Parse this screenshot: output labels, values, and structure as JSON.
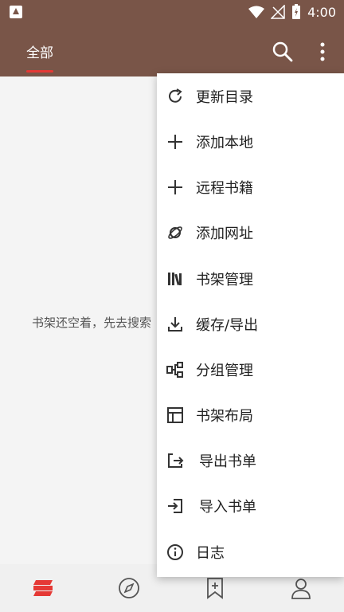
{
  "status_bar": {
    "time": "4:00"
  },
  "app_bar": {
    "tab_all": "全部"
  },
  "content": {
    "empty_message": "书架还空着，先去搜索"
  },
  "menu": {
    "items": [
      {
        "label": "更新目录",
        "icon": "refresh-icon"
      },
      {
        "label": "添加本地",
        "icon": "plus-icon"
      },
      {
        "label": "远程书籍",
        "icon": "plus-icon"
      },
      {
        "label": "添加网址",
        "icon": "planet-icon"
      },
      {
        "label": "书架管理",
        "icon": "bookshelf-icon"
      },
      {
        "label": "缓存/导出",
        "icon": "download-icon"
      },
      {
        "label": "分组管理",
        "icon": "group-icon"
      },
      {
        "label": "书架布局",
        "icon": "layout-icon"
      },
      {
        "label": "导出书单",
        "icon": "export-icon"
      },
      {
        "label": "导入书单",
        "icon": "import-icon"
      },
      {
        "label": "日志",
        "icon": "info-icon"
      }
    ]
  },
  "colors": {
    "primary": "#795548",
    "accent": "#e53935"
  }
}
